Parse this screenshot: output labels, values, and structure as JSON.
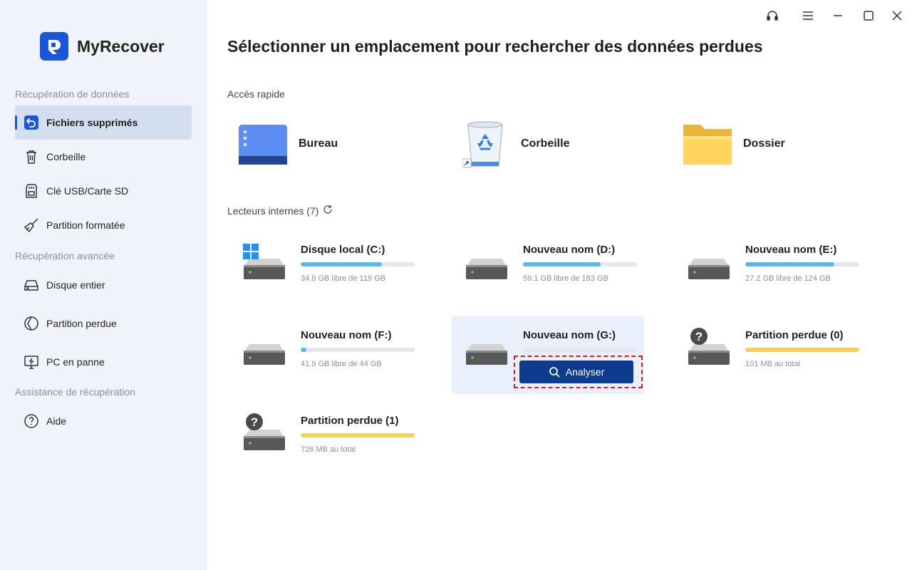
{
  "app": {
    "name": "MyRecover",
    "accent": "#1a56db"
  },
  "sidebar": {
    "sections": [
      {
        "title": "Récupération de données"
      },
      {
        "title": "Récupération avancée"
      },
      {
        "title": "Assistance de récupération"
      }
    ],
    "items": [
      {
        "label": "Fichiers supprimés",
        "icon": "undo-icon",
        "active": true
      },
      {
        "label": "Corbeille",
        "icon": "trash-icon"
      },
      {
        "label": "Clé USB/Carte SD",
        "icon": "sd-card-icon"
      },
      {
        "label": "Partition formatée",
        "icon": "broom-icon"
      },
      {
        "label": "Disque entier",
        "icon": "hard-disk-icon"
      },
      {
        "label": "Partition perdue",
        "icon": "lost-partition-icon"
      },
      {
        "label": "PC en panne",
        "icon": "crashed-pc-icon"
      },
      {
        "label": "Aide",
        "icon": "help-icon"
      }
    ]
  },
  "window_controls": [
    "headset-icon",
    "menu-icon",
    "minimize-icon",
    "maximize-icon",
    "close-icon"
  ],
  "main": {
    "title": "Sélectionner un emplacement pour rechercher des données perdues",
    "quick_access": {
      "label": "Accès rapide",
      "items": [
        {
          "label": "Bureau",
          "icon": "desktop-icon"
        },
        {
          "label": "Corbeille",
          "icon": "recycle-bin-icon"
        },
        {
          "label": "Dossier",
          "icon": "folder-icon"
        }
      ]
    },
    "drives": {
      "label": "Lecteurs internes (7)",
      "items": [
        {
          "name": "Disque local (C:)",
          "info": "34.8 GB libre de 119 GB",
          "used_fraction": 0.71,
          "color": "#5bb7f0",
          "badge": "windows"
        },
        {
          "name": "Nouveau nom (D:)",
          "info": "59.1 GB libre de 183 GB",
          "used_fraction": 0.68,
          "color": "#5bb7f0"
        },
        {
          "name": "Nouveau nom (E:)",
          "info": "27.2 GB libre de 124 GB",
          "used_fraction": 0.78,
          "color": "#5bb7f0"
        },
        {
          "name": "Nouveau nom (F:)",
          "info": "41.9 GB libre de 44 GB",
          "used_fraction": 0.05,
          "color": "#5bb7f0"
        },
        {
          "name": "Nouveau nom (G:)",
          "info": "",
          "used_fraction": 0,
          "color": "#5bb7f0",
          "hover": true
        },
        {
          "name": "Partition perdue (0)",
          "info": "101 MB au total",
          "used_fraction": 1,
          "color": "#f5cf5b",
          "badge": "question"
        },
        {
          "name": "Partition perdue (1)",
          "info": "726 MB au total",
          "used_fraction": 1,
          "color": "#f5cf5b",
          "badge": "question"
        }
      ]
    },
    "scan_button": {
      "label": "Analyser",
      "color": "#0d3c8f"
    }
  }
}
